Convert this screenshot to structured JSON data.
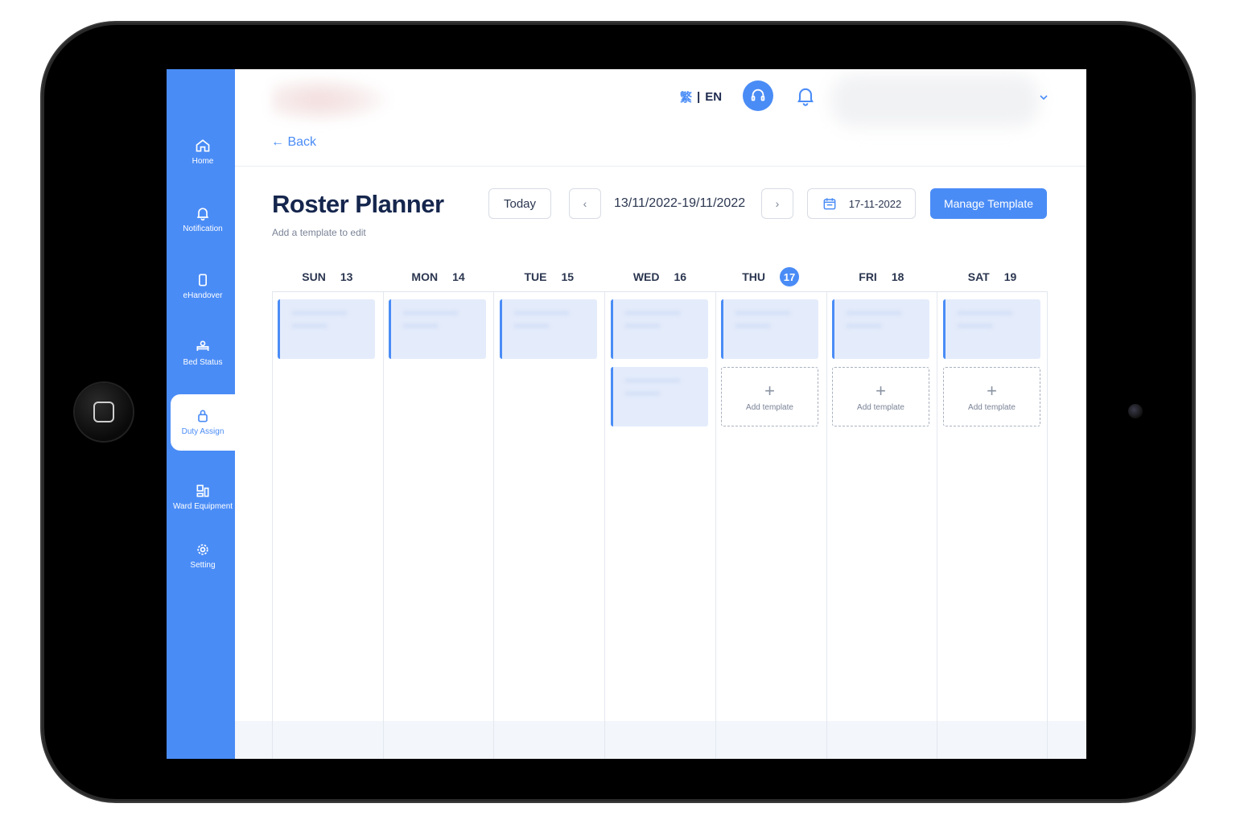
{
  "sidebar": {
    "items": [
      {
        "label": "Home"
      },
      {
        "label": "Notification"
      },
      {
        "label": "eHandover"
      },
      {
        "label": "Bed Status"
      },
      {
        "label": "Duty Assign"
      },
      {
        "label": "Ward Equipment"
      },
      {
        "label": "Setting"
      }
    ],
    "active": "Duty Assign"
  },
  "header": {
    "lang_zh": "繁",
    "lang_sep": "|",
    "lang_en": "EN",
    "back_label": "← Back"
  },
  "toolbar": {
    "title": "Roster Planner",
    "subtitle": "Add a template to edit",
    "today_label": "Today",
    "prev_label": "‹",
    "next_label": "›",
    "date_range": "13/11/2022-19/11/2022",
    "selected_date": "17-11-2022",
    "manage_label": "Manage Template"
  },
  "calendar": {
    "days": [
      {
        "name": "SUN",
        "date": "13"
      },
      {
        "name": "MON",
        "date": "14"
      },
      {
        "name": "TUE",
        "date": "15"
      },
      {
        "name": "WED",
        "date": "16"
      },
      {
        "name": "THU",
        "date": "17"
      },
      {
        "name": "FRI",
        "date": "18"
      },
      {
        "name": "SAT",
        "date": "19"
      }
    ],
    "today": "17",
    "add_template_label": "Add template"
  },
  "colors": {
    "accent": "#4a8cf6",
    "title": "#15264d",
    "shift_bg": "#e4ecfb"
  }
}
